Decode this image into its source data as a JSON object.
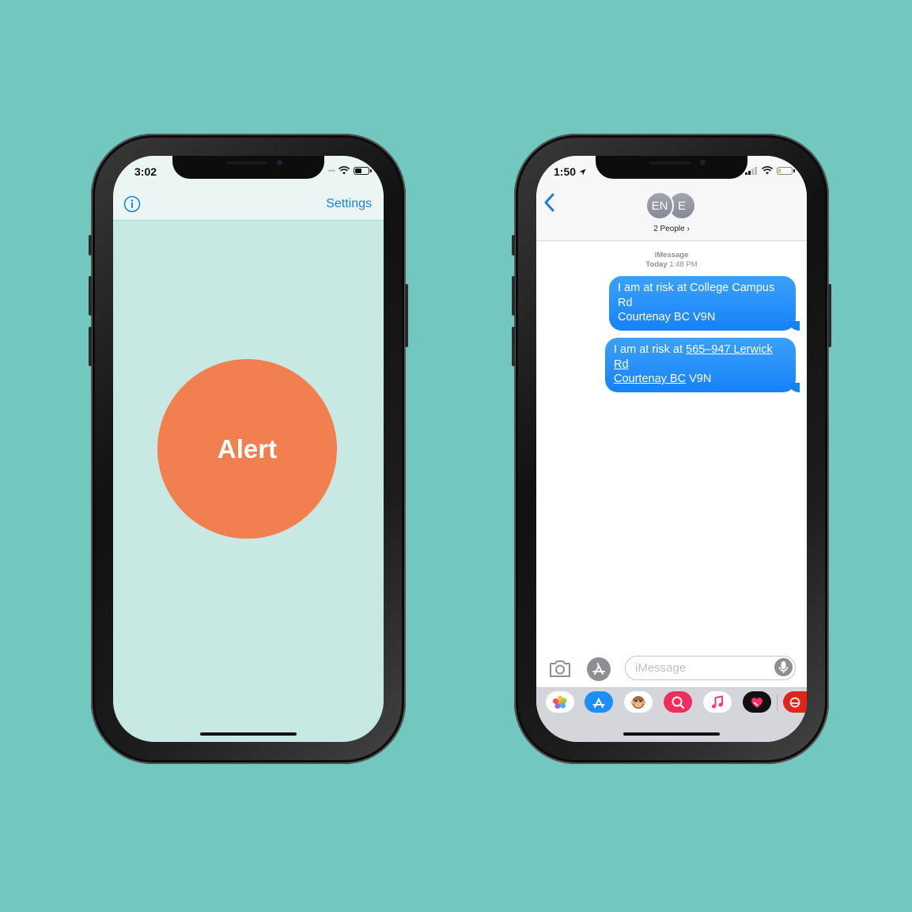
{
  "left_phone": {
    "status_time": "3:02",
    "nav": {
      "settings_label": "Settings"
    },
    "alert_button_label": "Alert",
    "colors": {
      "accent": "#1a7fd9",
      "alert": "#f27f4f",
      "background": "#c8e8e4"
    }
  },
  "right_phone": {
    "status_time": "1:50",
    "header": {
      "avatars": [
        "EN",
        "E"
      ],
      "people_label": "2 People ›"
    },
    "thread_meta": {
      "service": "iMessage",
      "day": "Today",
      "time": "1:48 PM"
    },
    "messages": [
      {
        "line1": "I am at risk at College Campus",
        "line2": "Rd",
        "line3": "Courtenay BC V9N"
      },
      {
        "line1_prefix": "I am at risk at ",
        "line1_link": "565–947 Lerwick",
        "line2_link": "Rd",
        "line3_link": "Courtenay BC",
        "line3_suffix": " V9N"
      }
    ],
    "compose": {
      "placeholder": "iMessage"
    },
    "app_tray": [
      "photos-app-icon",
      "app-store-icon",
      "animoji-icon",
      "search-images-icon",
      "music-icon",
      "digital-touch-icon",
      "bank-app-icon"
    ],
    "colors": {
      "bubble": "#1682fa",
      "tray": "#d4d6dc"
    }
  }
}
